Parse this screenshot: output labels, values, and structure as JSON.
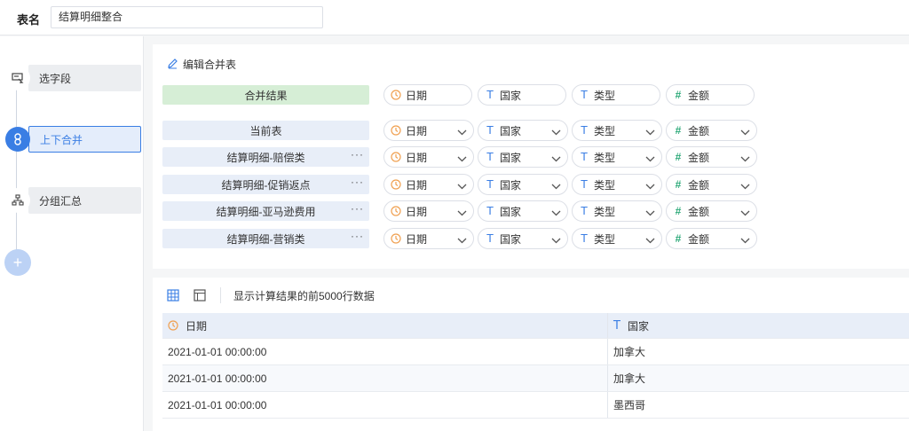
{
  "header": {
    "table_name_label": "表名",
    "table_name_value": "结算明细整合"
  },
  "steps": [
    {
      "label": "选字段",
      "icon": "select-field-icon",
      "active": false
    },
    {
      "label": "上下合并",
      "icon": "merge-link-icon",
      "active": true
    },
    {
      "label": "分组汇总",
      "icon": "group-tree-icon",
      "active": false
    }
  ],
  "add_step_label": "+",
  "merge": {
    "title": "编辑合并表",
    "result_label": "合并结果",
    "result_fields": [
      {
        "type": "date",
        "label": "日期"
      },
      {
        "type": "text",
        "label": "国家"
      },
      {
        "type": "text",
        "label": "类型"
      },
      {
        "type": "number",
        "label": "金额"
      }
    ],
    "tables": [
      {
        "name": "当前表",
        "has_menu": false
      },
      {
        "name": "结算明细-赔偿类",
        "has_menu": true
      },
      {
        "name": "结算明细-促销返点",
        "has_menu": true
      },
      {
        "name": "结算明细-亚马逊费用",
        "has_menu": true
      },
      {
        "name": "结算明细-营销类",
        "has_menu": true
      }
    ],
    "table_fields": [
      {
        "type": "date",
        "label": "日期"
      },
      {
        "type": "text",
        "label": "国家"
      },
      {
        "type": "text",
        "label": "类型"
      },
      {
        "type": "number",
        "label": "金额"
      }
    ],
    "menu_label": "···"
  },
  "preview": {
    "caption": "显示计算结果的前5000行数据",
    "columns": [
      {
        "type": "date",
        "label": "日期"
      },
      {
        "type": "text",
        "label": "国家"
      }
    ],
    "rows": [
      [
        "2021-01-01 00:00:00",
        "加拿大"
      ],
      [
        "2021-01-01 00:00:00",
        "加拿大"
      ],
      [
        "2021-01-01 00:00:00",
        "墨西哥"
      ]
    ]
  },
  "colors": {
    "accent": "#3a7ee4",
    "date_icon": "#f0a050",
    "text_icon": "#3a7ee4",
    "number_icon": "#2eaa7a",
    "result_bg": "#d6eed6",
    "row_bg": "#e8eef8"
  }
}
